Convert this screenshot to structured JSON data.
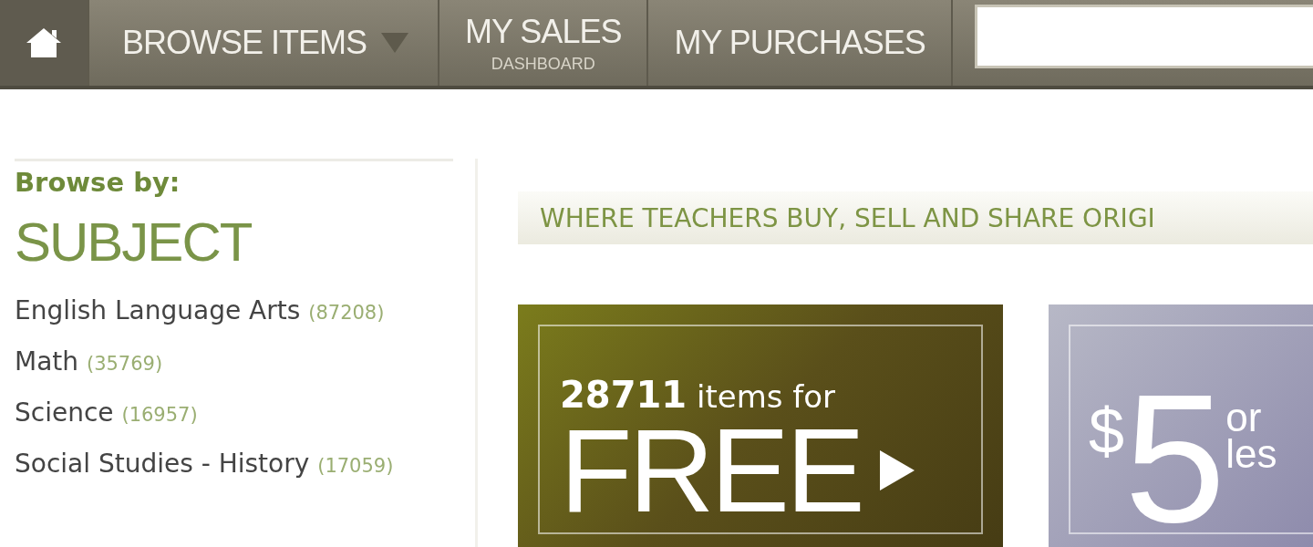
{
  "nav": {
    "items": [
      {
        "kind": "home"
      },
      {
        "kind": "dropdown",
        "label": "BROWSE ITEMS"
      },
      {
        "kind": "link",
        "label": "MY SALES",
        "sublabel": "DASHBOARD"
      },
      {
        "kind": "link",
        "label": "MY PURCHASES"
      },
      {
        "kind": "search"
      }
    ]
  },
  "sidebar": {
    "heading": "Browse by:",
    "title": "SUBJECT",
    "items": [
      {
        "label": "English Language Arts",
        "count": "(87208)"
      },
      {
        "label": "Math",
        "count": "(35769)"
      },
      {
        "label": "Science",
        "count": "(16957)"
      },
      {
        "label": "Social Studies - History",
        "count": "(17059)"
      }
    ]
  },
  "banner": {
    "text": "WHERE TEACHERS BUY, SELL AND SHARE ORIGI"
  },
  "promos": [
    {
      "kind": "free",
      "count": "28711",
      "text": "items for",
      "big": "FREE"
    },
    {
      "kind": "price",
      "currency": "$",
      "amount": "5",
      "line1": "or",
      "line2": "les"
    }
  ]
}
